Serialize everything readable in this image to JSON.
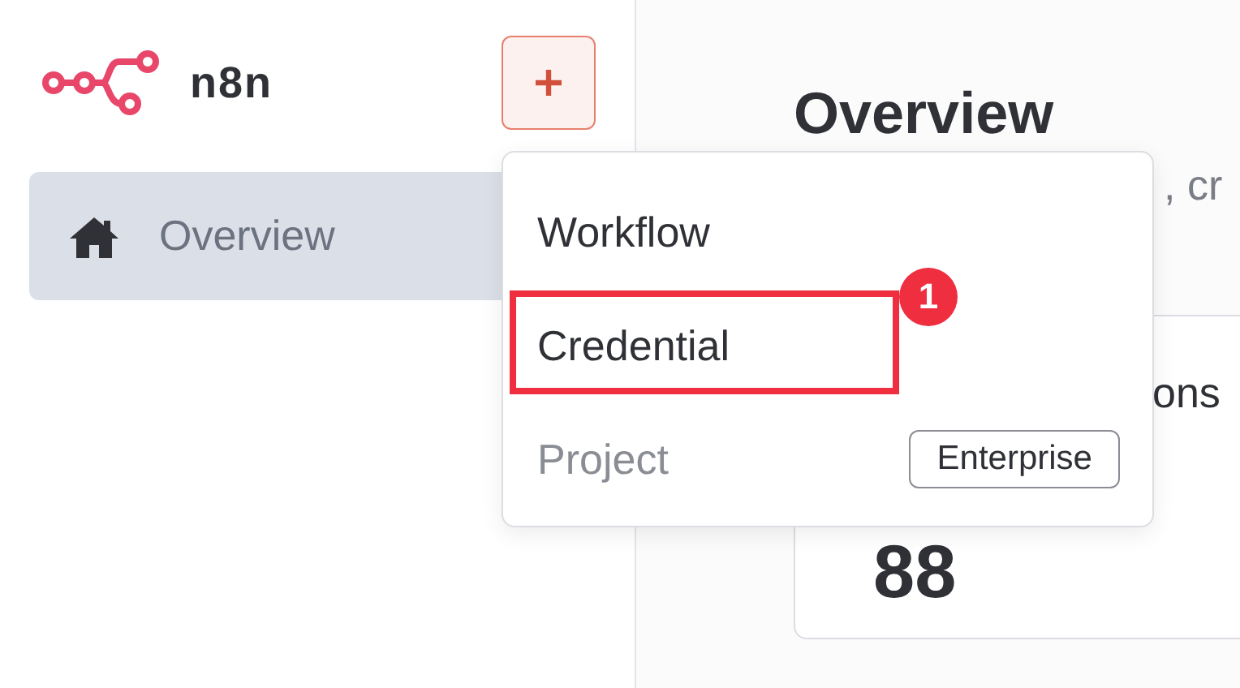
{
  "sidebar": {
    "logo": "n8n",
    "items": [
      {
        "label": "Overview",
        "selected": true
      }
    ]
  },
  "main": {
    "title": "Overview",
    "subtitle": ", cr",
    "card": {
      "label": "ons",
      "value": "88"
    }
  },
  "dropdown": {
    "items": [
      {
        "label": "Workflow",
        "disabled": false,
        "highlighted": false
      },
      {
        "label": "Credential",
        "disabled": false,
        "highlighted": true,
        "annotation": "1"
      },
      {
        "label": "Project",
        "disabled": true,
        "highlighted": false,
        "tag": "Enterprise"
      }
    ]
  }
}
